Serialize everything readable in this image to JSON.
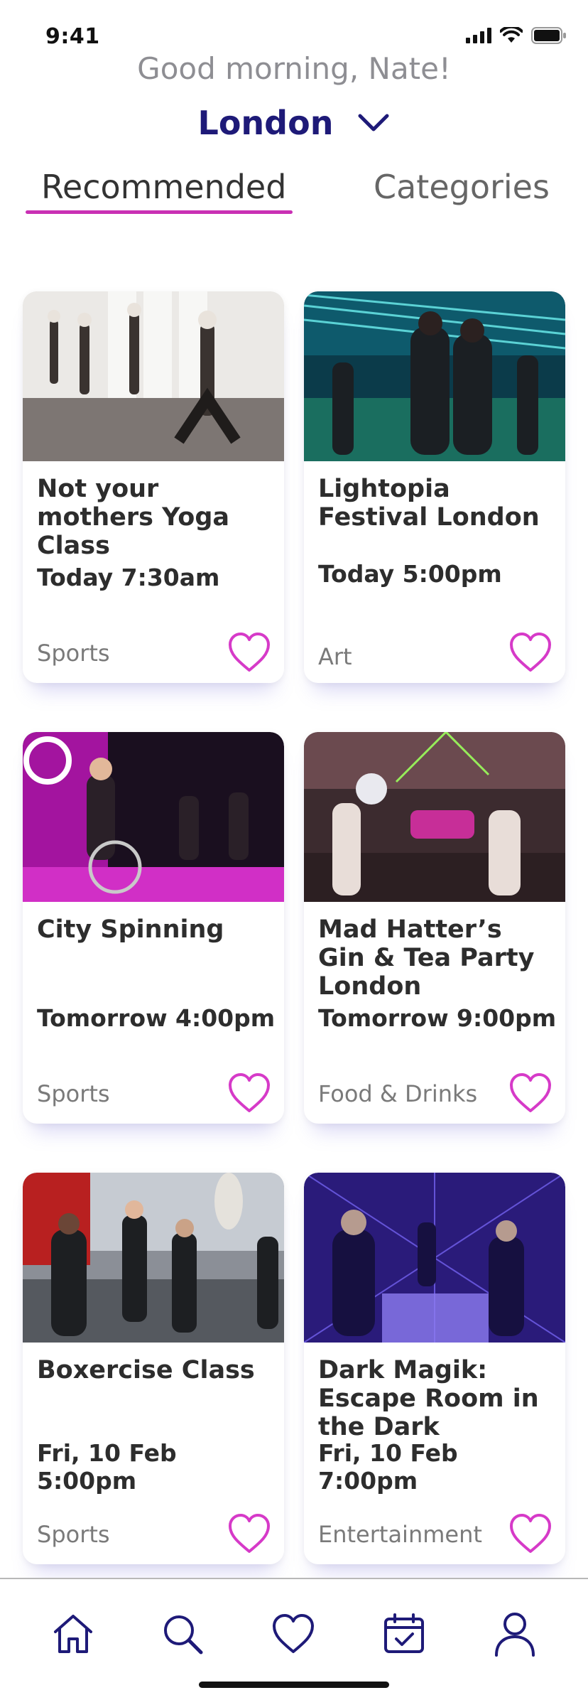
{
  "status_bar": {
    "time": "9:41"
  },
  "header": {
    "greeting": "Good morning, Nate!",
    "city": "London"
  },
  "tabs": [
    {
      "label": "Recommended",
      "active": true
    },
    {
      "label": "Categories",
      "active": false
    }
  ],
  "events": [
    {
      "title": "Not your mothers Yoga Class",
      "time": "Today 7:30am",
      "category": "Sports",
      "image": "yoga-class-photo"
    },
    {
      "title": "Lightopia Festival London",
      "time": "Today 5:00pm",
      "category": "Art",
      "image": "light-festival-photo"
    },
    {
      "title": "City Spinning",
      "time": "Tomorrow 4:00pm",
      "category": "Sports",
      "image": "spinning-class-photo"
    },
    {
      "title": "Mad Hatter’s Gin & Tea Party London",
      "time": "Tomorrow 9:00pm",
      "category": "Food & Drinks",
      "image": "tea-party-photo"
    },
    {
      "title": "Boxercise Class",
      "time": "Fri, 10 Feb 5:00pm",
      "category": "Sports",
      "image": "boxing-class-photo"
    },
    {
      "title": "Dark Magik: Escape Room in the Dark",
      "time": "Fri, 10 Feb 7:00pm",
      "category": "Entertainment",
      "image": "escape-room-photo"
    }
  ],
  "bottom_nav": [
    {
      "icon": "home-icon"
    },
    {
      "icon": "search-icon"
    },
    {
      "icon": "heart-icon"
    },
    {
      "icon": "calendar-icon"
    },
    {
      "icon": "profile-icon"
    }
  ],
  "colors": {
    "accent": "#c930b4",
    "brand": "#1e1a78",
    "heart": "#d63ac8",
    "card_shadow": "#786edc"
  }
}
